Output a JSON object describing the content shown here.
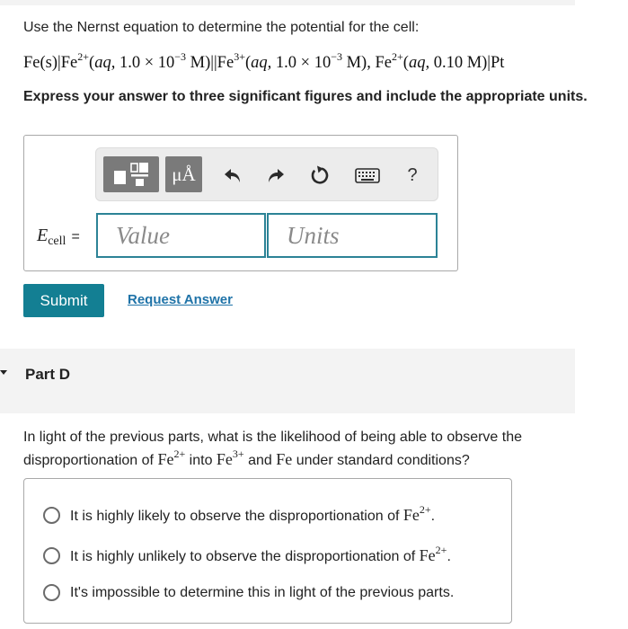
{
  "intro": "Use the Nernst equation to determine the potential for the cell:",
  "equation": {
    "p1": "Fe(s)|Fe",
    "c1": "2+",
    "p2": "(",
    "aq": "aq,",
    "p3": " 1.0 × 10",
    "e1": "−3",
    "p4": " M)||Fe",
    "c2": "3+",
    "p5": "(",
    "aq2": "aq,",
    "p6": " 1.0 × 10",
    "e2": "−3",
    "p7": " M), Fe",
    "c3": "2+",
    "p8": "(",
    "aq3": "aq,",
    "p9": " 0.10 M)|Pt"
  },
  "instruction": "Express your answer to three significant figures and include the appropriate units.",
  "toolbar": {
    "units_label": "μÅ",
    "help_label": "?",
    "icons": [
      "templates-icon",
      "units-icon",
      "undo-icon",
      "redo-icon",
      "reset-icon",
      "keyboard-icon",
      "help-icon"
    ]
  },
  "answer": {
    "label_main": "E",
    "label_sub": "cell",
    "label_eq": "=",
    "value_placeholder": "Value",
    "units_placeholder": "Units"
  },
  "actions": {
    "submit": "Submit",
    "request": "Request Answer"
  },
  "part_d": {
    "title": "Part D",
    "q_a": "In light of the previous parts, what is the likelihood of being able to observe the disproportionation of ",
    "fe": "Fe",
    "c2": "2+",
    "q_b": " into ",
    "c3": "3+",
    "q_c": " and ",
    "q_d": " under standard conditions?",
    "choices": [
      {
        "text": "It is highly likely to observe the disproportionation of ",
        "fe": "Fe",
        "charge": "2+",
        "end": "."
      },
      {
        "text": "It is highly unlikely to observe the disproportionation of ",
        "fe": "Fe",
        "charge": "2+",
        "end": "."
      },
      {
        "text": "It's impossible to determine this in light of the previous parts."
      }
    ]
  },
  "colors": {
    "accent": "#137f93",
    "input_border": "#2c8396",
    "link": "#1f73a8",
    "toolbar_bg": "#ececec",
    "section_bg": "#f3f3f3"
  }
}
